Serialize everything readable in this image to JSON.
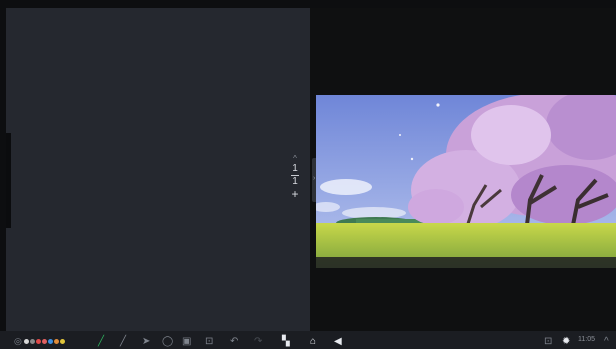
{
  "page_indicator": {
    "current": "1",
    "total": "1",
    "add_label": "+",
    "up_glyph": "^"
  },
  "split_handle_glyph": "›",
  "taskbar": {
    "clock": "11:05",
    "pen_colors": [
      "#d7d7d7",
      "#8a8a8a",
      "#e04a4a",
      "#e06060",
      "#3d8fe0",
      "#e08c3a",
      "#e0c43a"
    ]
  },
  "media_caption": "",
  "colors": {
    "left_pane": "#25282f",
    "right_pane": "#0f1011",
    "taskbar": "#1b1d22",
    "accent_green": "#2fae5d"
  }
}
